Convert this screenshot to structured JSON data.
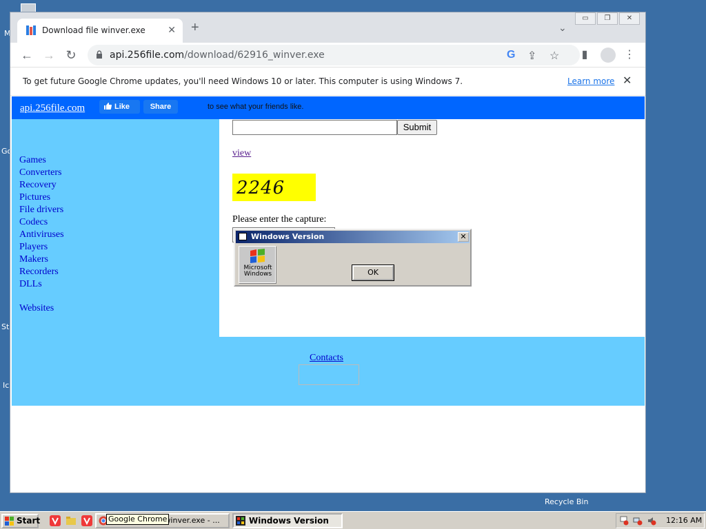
{
  "desktop": {
    "left_fragments": [
      "M",
      "Go",
      "Sta",
      "Ic"
    ],
    "recycle_bin_label": "Recycle Bin"
  },
  "browser": {
    "tab_title": "Download file winver.exe",
    "url_host": "api.256file.com",
    "url_path": "/download/62916_winver.exe",
    "infobar_text": "To get future Google Chrome updates, you'll need Windows 10 or later. This computer is using Windows 7.",
    "infobar_link": "Learn more"
  },
  "site": {
    "header_link": "api.256file.com",
    "like_label": "Like",
    "share_label": "Share",
    "friends_text": "to see what your friends like.",
    "sidebar_items": [
      "Games",
      "Converters",
      "Recovery",
      "Pictures",
      "File drivers",
      "Codecs",
      "Antiviruses",
      "Players",
      "Makers",
      "Recorders",
      "DLLs"
    ],
    "websites_label": "Websites",
    "submit_label": "Submit",
    "view_link": "view",
    "captcha_image_text": "2246",
    "captcha_prompt": "Please enter the capture:",
    "captcha_value": "2246",
    "contacts_link": "Contacts"
  },
  "dialog": {
    "title": "Windows Version",
    "close_label": "✕",
    "logo_text_line1": "Microsoft",
    "logo_text_line2": "Windows",
    "ok_label": "OK"
  },
  "taskbar": {
    "start_label": "Start",
    "tooltip": "Google Chrome",
    "chrome_task_label": "Download file winver.exe - ...",
    "winver_task_label": "Windows Version",
    "clock": "12:16 AM"
  },
  "colors": {
    "desktop": "#3a6ea5",
    "site_header": "#0066ff",
    "site_sidebar": "#66ccff",
    "captcha_bg": "#ffff00"
  }
}
